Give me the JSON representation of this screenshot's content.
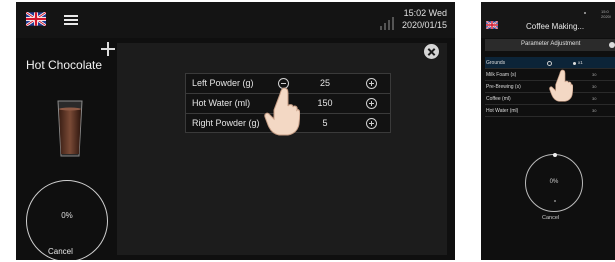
{
  "main": {
    "time": "15:02 Wed",
    "date": "2020/01/15",
    "product_title": "Hot Chocolate",
    "progress": "0%",
    "cancel": "Cancel",
    "parameters": [
      {
        "label": "Left Powder (g)",
        "value": "25"
      },
      {
        "label": "Hot Water (ml)",
        "value": "150"
      },
      {
        "label": "Right Powder (g)",
        "value": "5"
      }
    ]
  },
  "secondary": {
    "time": "15:0\n2020/",
    "title": "Coffee Making...",
    "panel_title": "Parameter Adjustment",
    "rows": [
      {
        "label": "Grounds",
        "value": "",
        "extra": "x1"
      },
      {
        "label": "Milk Foam (s)",
        "value": "30"
      },
      {
        "label": "Pre-Brewing (s)",
        "value": "30"
      },
      {
        "label": "Coffee (ml)",
        "value": "30"
      },
      {
        "label": "Hot Water (ml)",
        "value": "30"
      }
    ],
    "progress": "0%",
    "cancel": "Cancel"
  },
  "colors": {
    "background": "#0f0f0f",
    "panel": "#1c1c1c",
    "highlight": "#0c2438"
  },
  "icons": [
    "uk-flag-icon",
    "menu-icon",
    "signal-icon",
    "plus-icon",
    "close-icon",
    "minus-icon",
    "pointing-hand-icon",
    "info-icon"
  ]
}
